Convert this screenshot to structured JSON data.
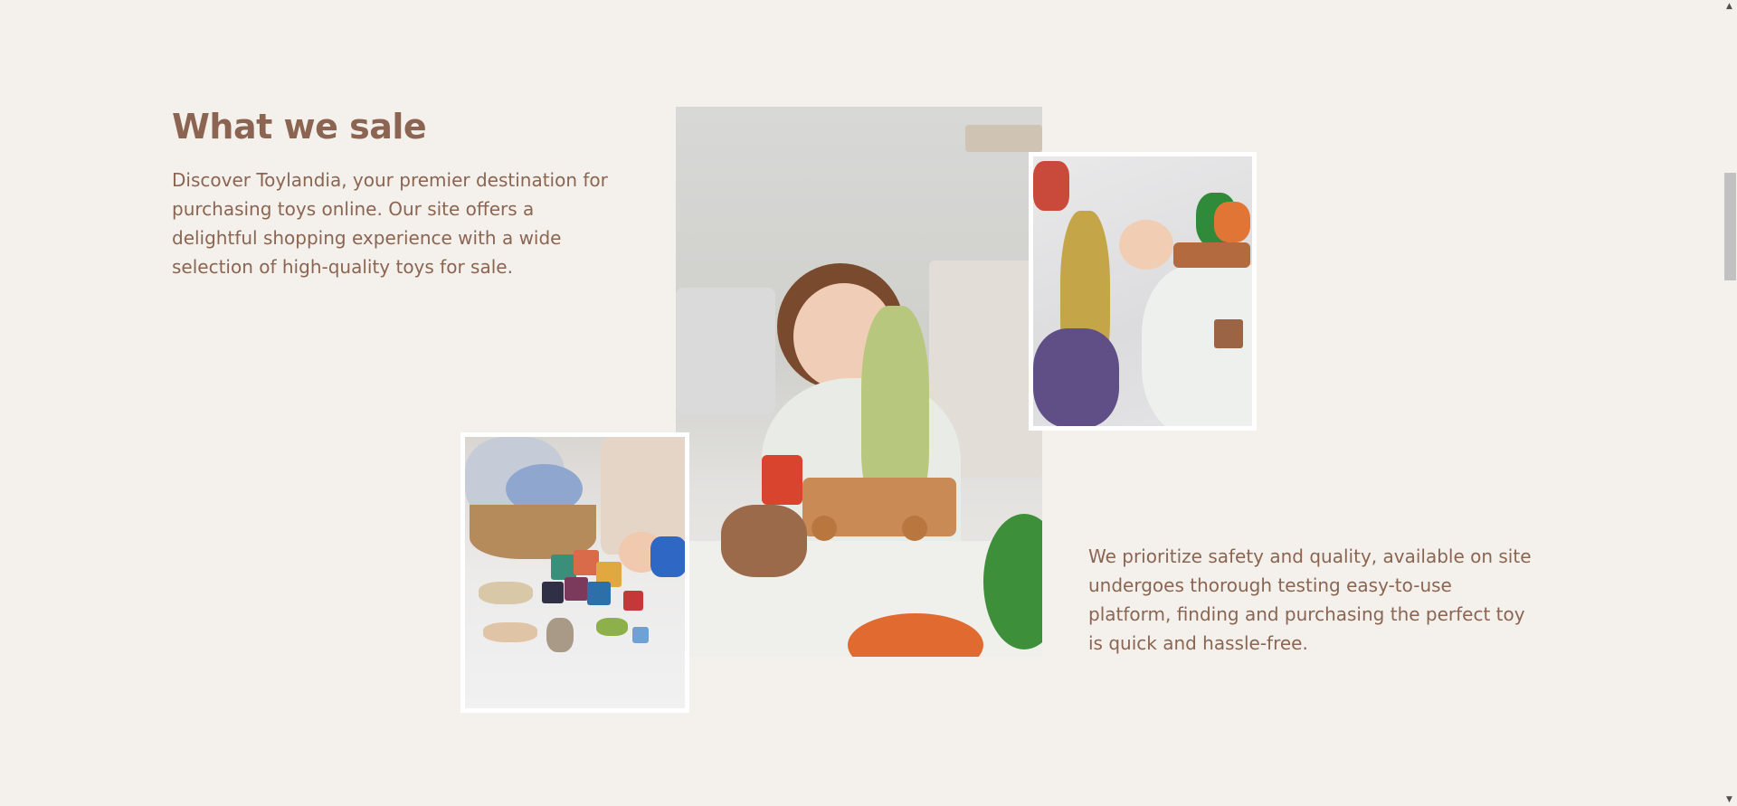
{
  "section": {
    "title": "What we sale",
    "intro": "Discover Toylandia, your premier destination for purchasing toys online. Our site offers a delightful shopping experience with a wide selection of high-quality toys for sale.",
    "outro": "We prioritize safety and quality, available on site undergoes thorough testing easy-to-use platform, finding and purchasing the perfect toy is quick and hassle-free."
  },
  "colors": {
    "background": "#f4f1ec",
    "text": "#8b6552"
  },
  "scrollbar": {
    "up_icon": "▲",
    "down_icon": "▼"
  }
}
